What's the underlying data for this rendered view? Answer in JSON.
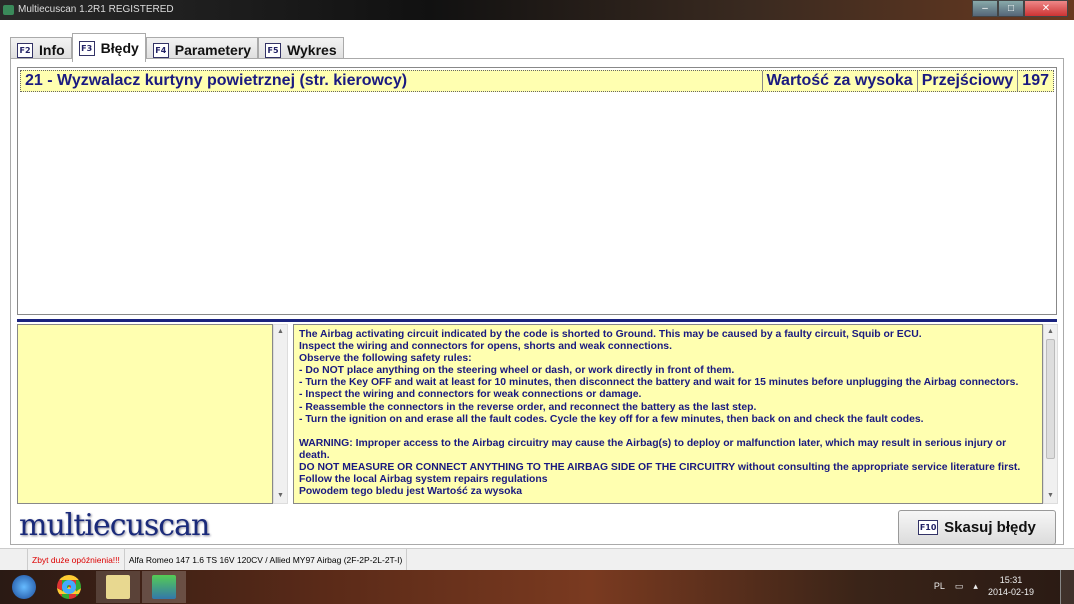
{
  "window": {
    "title": "Multiecuscan 1.2R1 REGISTERED"
  },
  "tabs": [
    {
      "key": "F2",
      "label": "Info"
    },
    {
      "key": "F3",
      "label": "Błędy"
    },
    {
      "key": "F4",
      "label": "Parametery"
    },
    {
      "key": "F5",
      "label": "Wykres"
    }
  ],
  "faults": [
    {
      "code_desc": "21 - Wyzwalacz kurtyny powietrznej (str. kierowcy)",
      "condition": "Wartość za wysoka",
      "type": "Przejściowy",
      "count": "197"
    }
  ],
  "description": "The Airbag activating circuit indicated by the code is shorted to Ground. This may be caused by a faulty circuit, Squib or ECU.\nInspect the wiring and connectors for opens, shorts and weak connections.\nObserve the following safety rules:\n- Do NOT place anything on the steering wheel or dash, or work directly in front of them.\n- Turn the Key OFF and wait at least for 10 minutes, then disconnect the battery and wait for 15 minutes before unplugging the Airbag connectors.\n- Inspect the wiring and connectors for weak connections or damage.\n- Reassemble the connectors in the reverse order, and reconnect the battery as the last step.\n- Turn the ignition on and erase all the fault codes. Cycle the key off for a few minutes, then back on and check the fault codes.\n\nWARNING: Improper access to the Airbag circuitry may cause the Airbag(s) to deploy or malfunction later, which may result in serious injury or death.\nDO NOT MEASURE OR CONNECT ANYTHING TO THE AIRBAG SIDE OF THE CIRCUITRY without consulting the appropriate service literature first.\nFollow the local Airbag system repairs regulations\nPowodem tego bledu jest Wartość za wysoka",
  "logo": "multiecuscan",
  "clear_button": {
    "key": "F10",
    "label": "Skasuj błędy"
  },
  "status": {
    "warning": "Zbyt duże opóźnienia!!!",
    "vehicle": "Alfa Romeo 147 1.6 TS 16V 120CV / Allied MY97 Airbag (2F-2P-2L-2T-I)"
  },
  "taskbar": {
    "lang": "PL",
    "time": "15:31",
    "date": "2014-02-19"
  }
}
